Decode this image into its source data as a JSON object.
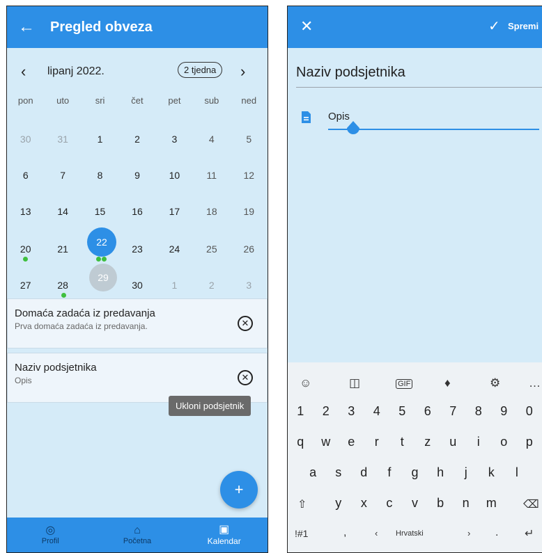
{
  "left": {
    "app_title": "Pregled obveza",
    "back_icon": "arrow-left-icon",
    "calendar": {
      "month_label": "lipanj 2022.",
      "format_button": "2 tjedna",
      "prev_icon": "chevron-left-icon",
      "next_icon": "chevron-right-icon",
      "weekdays": [
        "pon",
        "uto",
        "sri",
        "čet",
        "pet",
        "sub",
        "ned"
      ],
      "weeks": [
        [
          "30",
          "31",
          "1",
          "2",
          "3",
          "4",
          "5"
        ],
        [
          "6",
          "7",
          "8",
          "9",
          "10",
          "11",
          "12"
        ],
        [
          "13",
          "14",
          "15",
          "16",
          "17",
          "18",
          "19"
        ],
        [
          "20",
          "21",
          "22",
          "23",
          "24",
          "25",
          "26"
        ],
        [
          "27",
          "28",
          "29",
          "30",
          "1",
          "2",
          "3"
        ]
      ],
      "selected_day": "22",
      "today_day": "29"
    },
    "events": [
      {
        "title": "Domaća zadaća iz predavanja",
        "subtitle": "Prva domaća zadaća iz predavanja."
      },
      {
        "title": "Naziv podsjetnika",
        "subtitle": "Opis"
      }
    ],
    "tooltip": "Ukloni podsjetnik",
    "fab_label": "+",
    "nav": [
      {
        "label": "Profil",
        "icon": "profile-icon"
      },
      {
        "label": "Početna",
        "icon": "home-icon"
      },
      {
        "label": "Kalendar",
        "icon": "calendar-icon"
      }
    ],
    "colors": {
      "primary": "#2d8fe6",
      "background": "#d5ebf8",
      "dot": "#3fbf3f"
    }
  },
  "right": {
    "close_icon": "close-icon",
    "save_label": "Spremi",
    "title_placeholder": "Naziv podsjetnika",
    "description_label": "Opis",
    "keyboard": {
      "tools": [
        "emoji-icon",
        "sticker-icon",
        "gif-icon",
        "microphone-icon",
        "settings-icon",
        "more-icon"
      ],
      "row_numbers": [
        "1",
        "2",
        "3",
        "4",
        "5",
        "6",
        "7",
        "8",
        "9",
        "0"
      ],
      "row_q": [
        "q",
        "w",
        "e",
        "r",
        "t",
        "z",
        "u",
        "i",
        "o",
        "p"
      ],
      "row_a": [
        "a",
        "s",
        "d",
        "f",
        "g",
        "h",
        "j",
        "k",
        "l"
      ],
      "row_z": [
        "y",
        "x",
        "c",
        "v",
        "b",
        "n",
        "m"
      ],
      "symbols_key": "!#1",
      "comma_key": ",",
      "language": "Hrvatski",
      "period_key": "."
    }
  }
}
